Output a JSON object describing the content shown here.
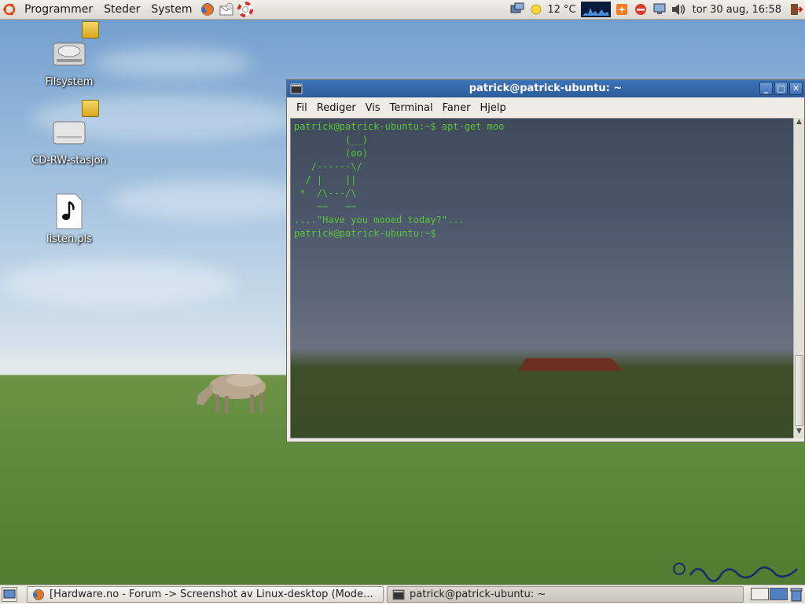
{
  "top_panel": {
    "menus": [
      "Programmer",
      "Steder",
      "System"
    ],
    "weather": "12 °C",
    "clock": "tor 30 aug, 16:58"
  },
  "desktop": {
    "icons": [
      {
        "label": "Filsystem",
        "icon": "hard-drive-icon"
      },
      {
        "label": "CD-RW-stasjon",
        "icon": "cd-drive-icon"
      },
      {
        "label": "listen.pls",
        "icon": "audio-file-icon"
      }
    ]
  },
  "terminal": {
    "title": "patrick@patrick-ubuntu: ~",
    "menus": [
      "Fil",
      "Rediger",
      "Vis",
      "Terminal",
      "Faner",
      "Hjelp"
    ],
    "output": "patrick@patrick-ubuntu:~$ apt-get moo\n         (__)\n         (oo)\n   /------\\/\n  / |    ||\n *  /\\---/\\\n    ~~   ~~\n....\"Have you mooed today?\"...\npatrick@patrick-ubuntu:~$"
  },
  "bottom_panel": {
    "tasks": [
      {
        "label": "[Hardware.no - Forum -> Screenshot av Linux-desktop (Mode...",
        "icon": "firefox-icon"
      },
      {
        "label": "patrick@patrick-ubuntu: ~",
        "icon": "terminal-icon"
      }
    ]
  },
  "colors": {
    "titlebar": "#3d73b7",
    "terminal_text": "#5ac53b",
    "panel": "#e8e5df"
  }
}
